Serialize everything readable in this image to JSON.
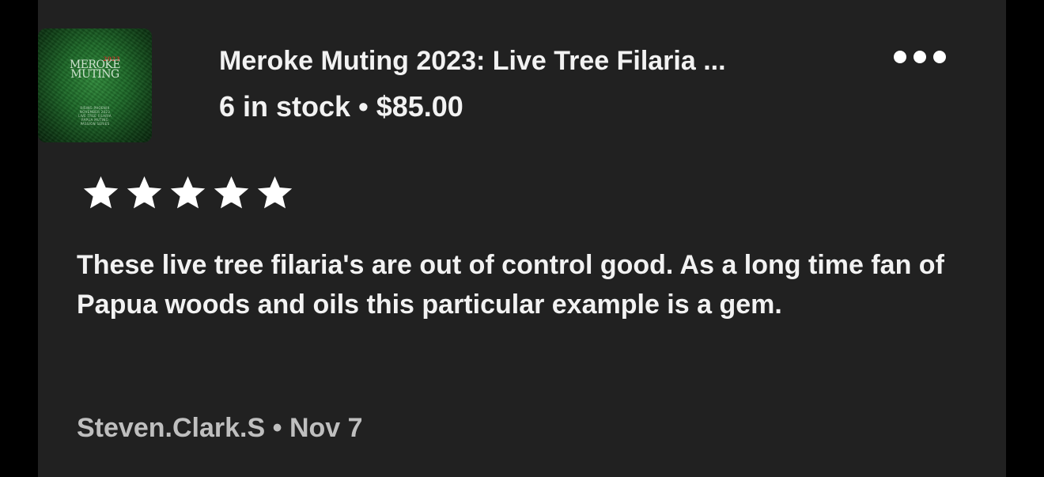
{
  "listing": {
    "thumbnail": {
      "year": "2023",
      "brand_line1": "MEROKE",
      "brand_line2": "MUTING",
      "small_text": [
        "RISING PHOENIX",
        "NOVEMBER 2023",
        "LIVE TREE FILARIA",
        "PAPUA MUTING",
        "PASSION SERIES"
      ]
    },
    "title": "Meroke Muting 2023: Live Tree Filaria ...",
    "stock": "6 in stock",
    "separator": "•",
    "price": "$85.00",
    "more_icon": "more-horizontal-icon"
  },
  "review": {
    "rating": 5,
    "rating_max": 5,
    "star_color": "#ffffff",
    "text": "These live tree filaria's are out of control good. As a long time fan of Papua woods and oils this particular example is a gem.",
    "author": "Steven.Clark.S",
    "separator": "•",
    "date": "Nov 7"
  },
  "colors": {
    "page_background": "#000000",
    "card_background": "#212121",
    "primary_text": "#f2f2f2",
    "secondary_text": "#bfbfbf"
  }
}
